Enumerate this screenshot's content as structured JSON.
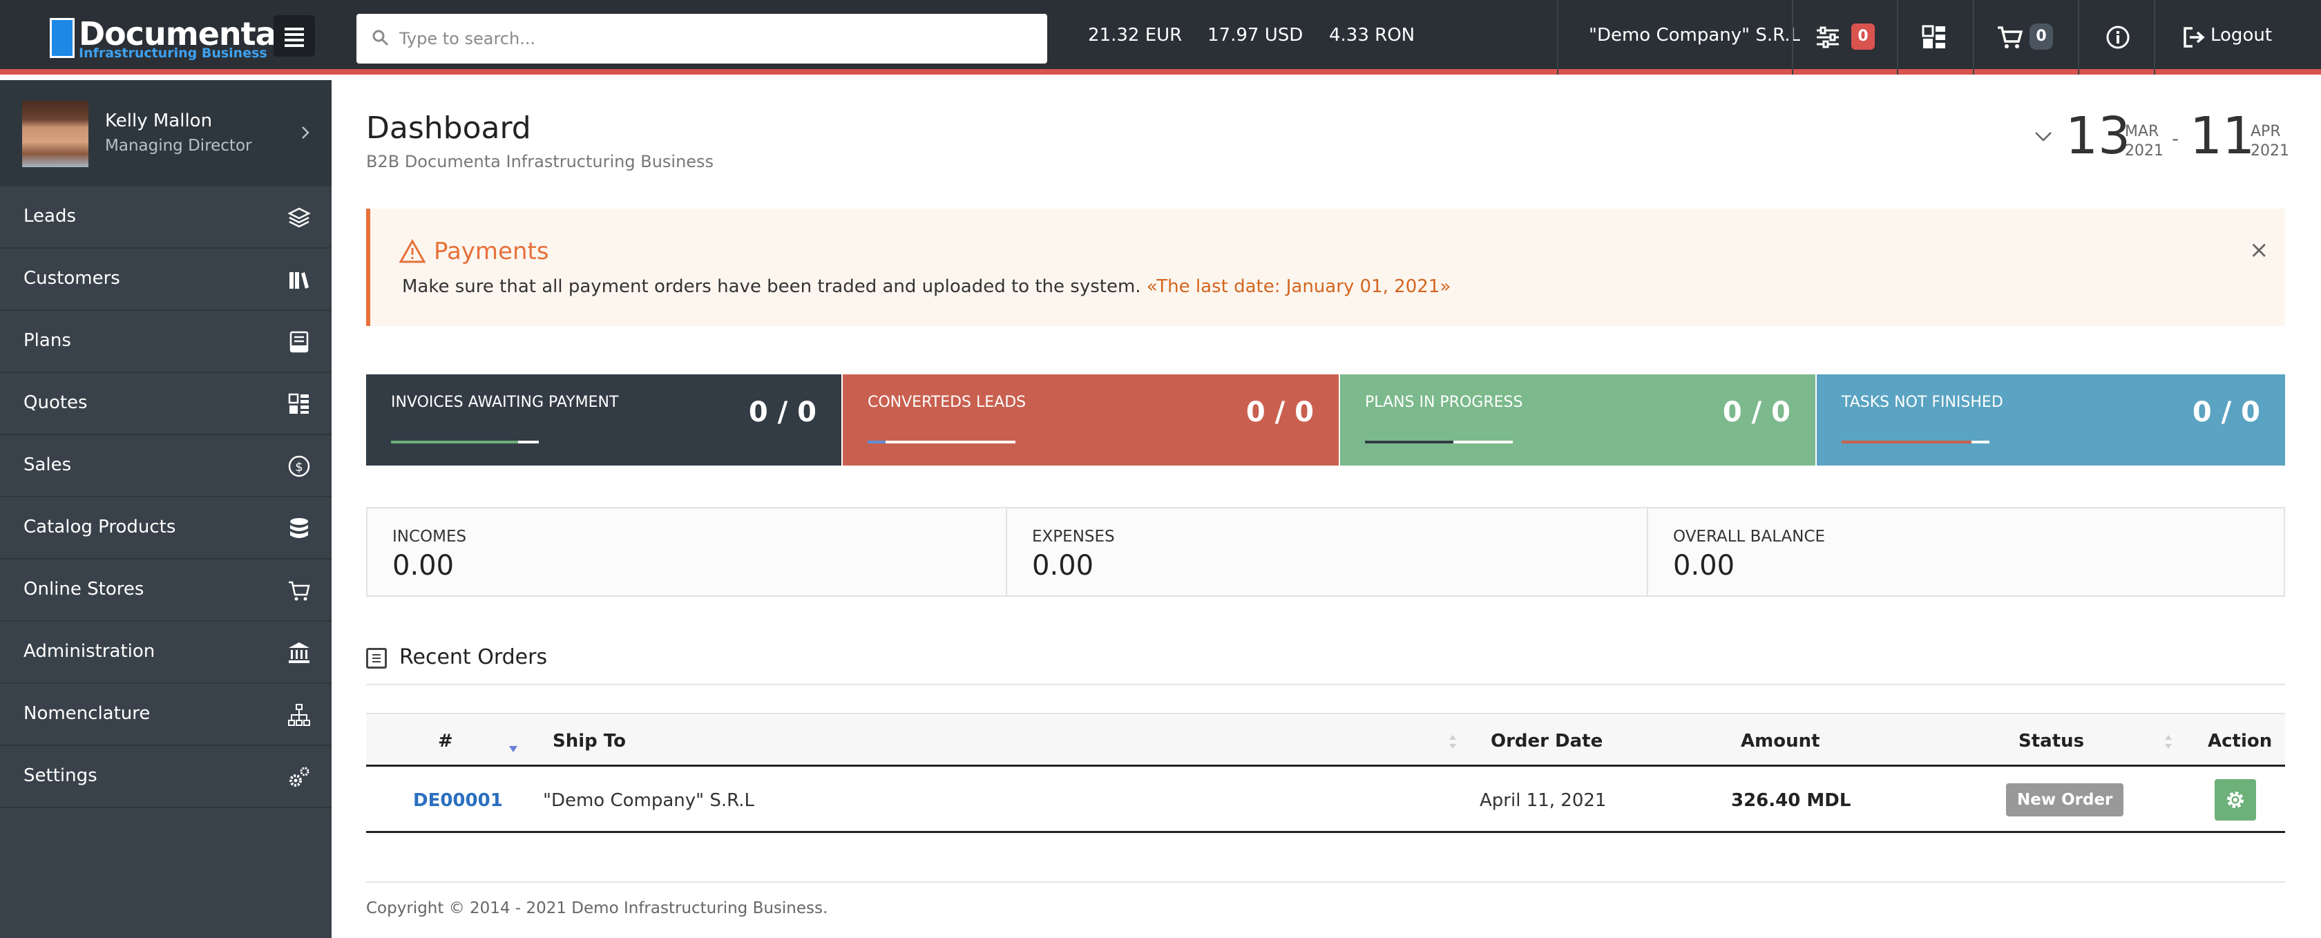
{
  "app": {
    "logo_name": "Documenta",
    "logo_sub": "Infrastructuring Business"
  },
  "topbar": {
    "search_placeholder": "Type to search...",
    "rates": [
      "21.32 EUR",
      "17.97 USD",
      "4.33 RON"
    ],
    "company": "\"Demo Company\" S.R.L",
    "filters_count": "0",
    "cart_count": "0",
    "logout_label": "Logout",
    "accent_red": "#d9534f"
  },
  "profile": {
    "name": "Kelly Mallon",
    "role": "Managing Director"
  },
  "sidebar": {
    "items": [
      {
        "label": "Leads",
        "icon": "layers-icon"
      },
      {
        "label": "Customers",
        "icon": "books-icon"
      },
      {
        "label": "Plans",
        "icon": "tray-icon"
      },
      {
        "label": "Quotes",
        "icon": "grid-list-icon"
      },
      {
        "label": "Sales",
        "icon": "dollar-circle-icon"
      },
      {
        "label": "Catalog Products",
        "icon": "database-icon"
      },
      {
        "label": "Online Stores",
        "icon": "cart-icon"
      },
      {
        "label": "Administration",
        "icon": "bank-icon"
      },
      {
        "label": "Nomenclature",
        "icon": "sitemap-icon"
      },
      {
        "label": "Settings",
        "icon": "gears-icon"
      }
    ]
  },
  "page": {
    "title": "Dashboard",
    "subtitle": "B2B Documenta Infrastructuring Business"
  },
  "daterange": {
    "start_day": "13",
    "start_month": "MAR",
    "start_year": "2021",
    "separator": "-",
    "end_day": "11",
    "end_month": "APR",
    "end_year": "2021"
  },
  "alert": {
    "title": "Payments",
    "text": "Make sure that all payment orders have been traded and uploaded to the system.",
    "link": "«The last date: January 01, 2021»",
    "close": "×"
  },
  "stats": [
    {
      "title": "INVOICES AWAITING PAYMENT",
      "value": "0 / 0",
      "color": "#333c45",
      "progress": 0.86,
      "fill": "#6db07a"
    },
    {
      "title": "CONVERTEDS LEADS",
      "value": "0 / 0",
      "color": "#c9604f",
      "progress": 0.12,
      "fill": "#5b8fd6"
    },
    {
      "title": "PLANS IN PROGRESS",
      "value": "0 / 0",
      "color": "#7cb98c",
      "progress": 0.6,
      "fill": "#333c45"
    },
    {
      "title": "TASKS NOT FINISHED",
      "value": "0 / 0",
      "color": "#5aa3c2",
      "progress": 0.88,
      "fill": "#c9604f"
    }
  ],
  "balances": [
    {
      "label": "INCOMES",
      "value": "0.00"
    },
    {
      "label": "EXPENSES",
      "value": "0.00"
    },
    {
      "label": "OVERALL BALANCE",
      "value": "0.00"
    }
  ],
  "recent_orders": {
    "title": "Recent Orders",
    "columns": [
      "#",
      "Ship To",
      "Order Date",
      "Amount",
      "Status",
      "Action"
    ],
    "rows": [
      {
        "id": "DE00001",
        "ship_to": "\"Demo Company\" S.R.L",
        "date": "April 11, 2021",
        "amount": "326.40 MDL",
        "status": "New Order"
      }
    ]
  },
  "footer": {
    "text": "Copyright © 2014 - 2021 Demo Infrastructuring Business."
  }
}
